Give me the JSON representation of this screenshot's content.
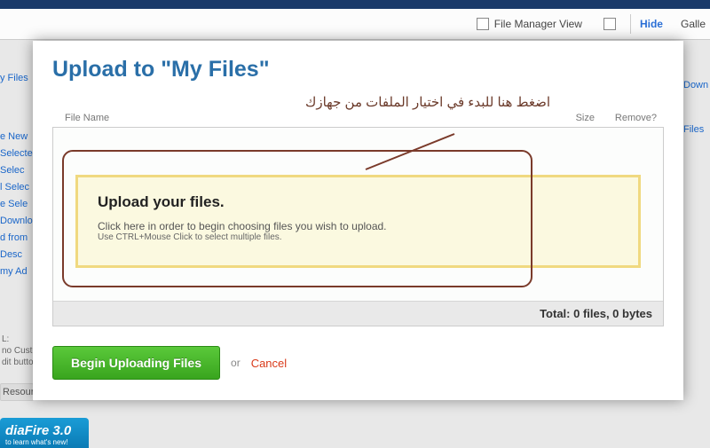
{
  "toolbar": {
    "file_manager_view": "File Manager View",
    "hide": "Hide",
    "galle": "Galle"
  },
  "sidebar": {
    "items": [
      "y Files",
      "e New",
      "Selecte",
      "Selec",
      "l Selec",
      "e Sele",
      "Downlo",
      "d from",
      "Desc",
      "my Ad"
    ]
  },
  "right_links": {
    "down": "Down",
    "files": "Files"
  },
  "bottom_left": {
    "l": "L:",
    "no_custo": "no Custo",
    "dit_butto": "dit butto"
  },
  "resour": "Resour",
  "mf_badge": {
    "name": "diaFire 3.0",
    "sub": "to learn what's new!"
  },
  "modal": {
    "title": "Upload to \"My Files\"",
    "annotation_ar": "اضغط هنا للبدء في اختيار الملفات من جهازك",
    "headers": {
      "name": "File Name",
      "size": "Size",
      "remove": "Remove?"
    },
    "upload_zone": {
      "heading": "Upload your files.",
      "line1": "Click here in order to begin choosing files you wish to upload.",
      "line2": "Use CTRL+Mouse Click to select multiple files."
    },
    "total": "Total: 0 files, 0 bytes",
    "begin_btn": "Begin Uploading Files",
    "or": "or",
    "cancel": "Cancel"
  }
}
